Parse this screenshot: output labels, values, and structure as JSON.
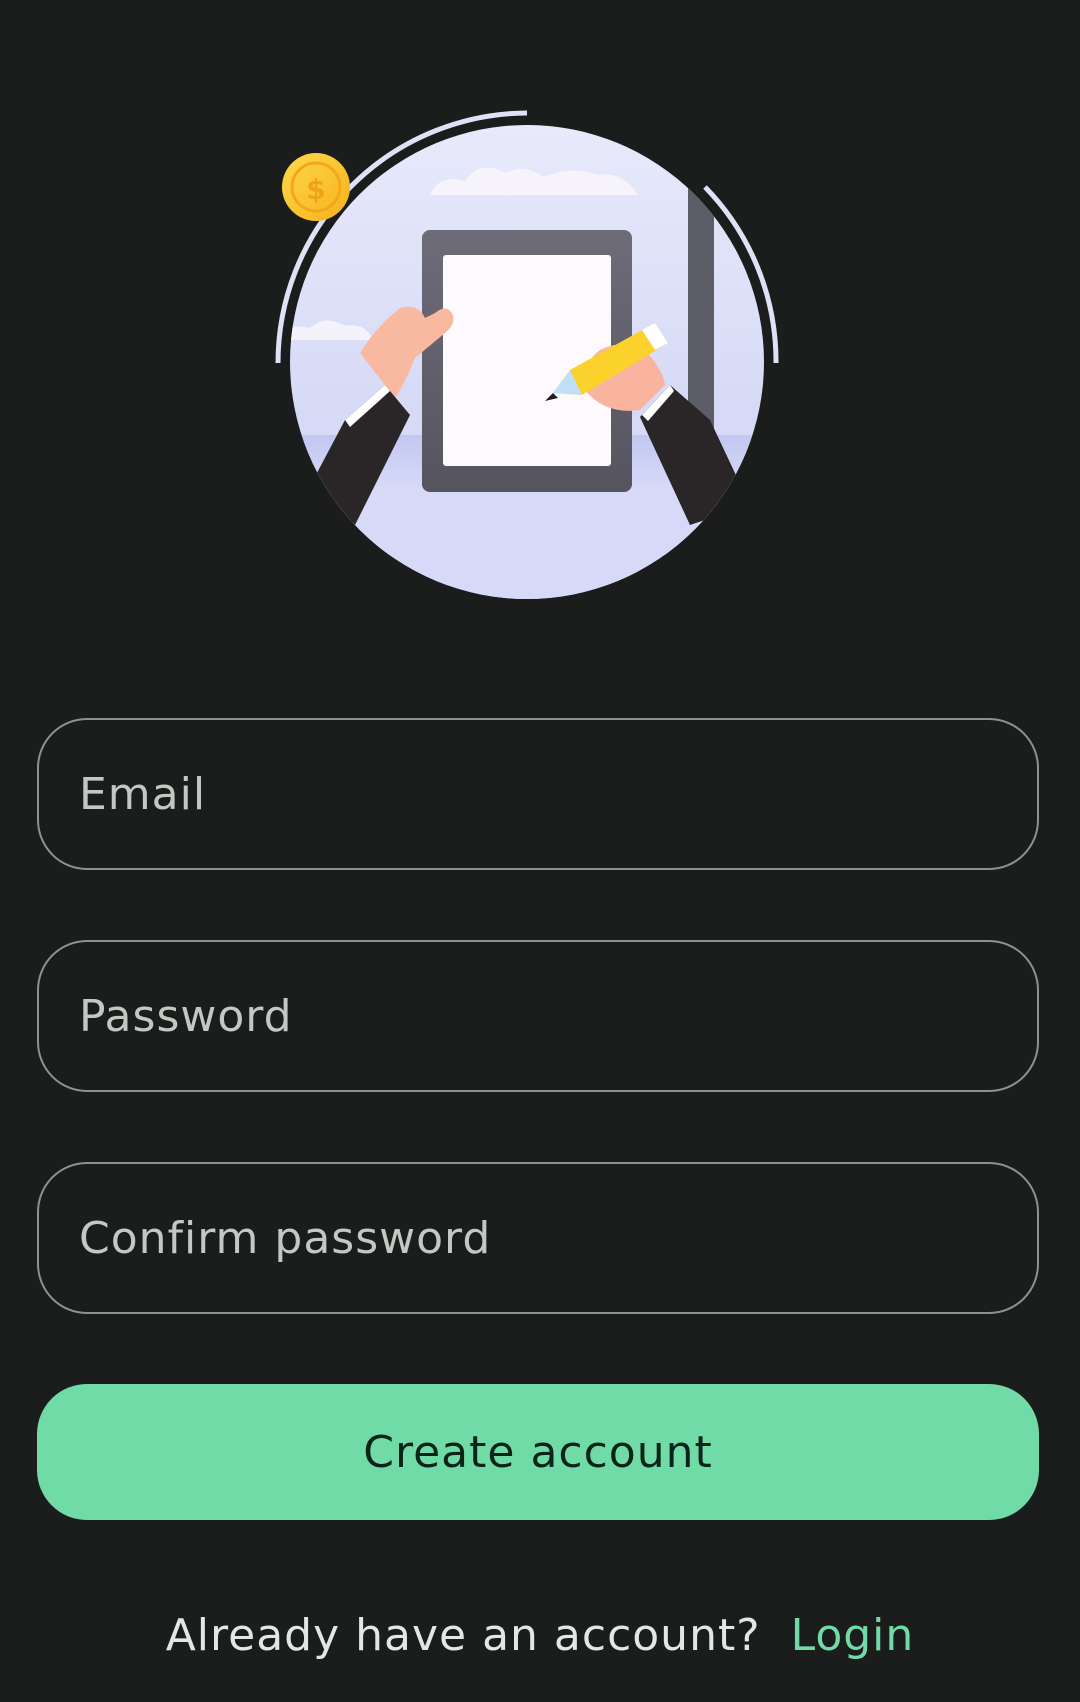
{
  "illustration": {
    "icon": "signing-tablet-illustration"
  },
  "form": {
    "email_placeholder": "Email",
    "password_placeholder": "Password",
    "confirm_placeholder": "Confirm password",
    "submit_label": "Create account"
  },
  "footer": {
    "question": "Already have an account?",
    "login_label": "Login"
  },
  "colors": {
    "background": "#1b1c1c",
    "accent": "#71dba8",
    "field_border": "#8e9190",
    "placeholder": "#c3c8c3"
  }
}
